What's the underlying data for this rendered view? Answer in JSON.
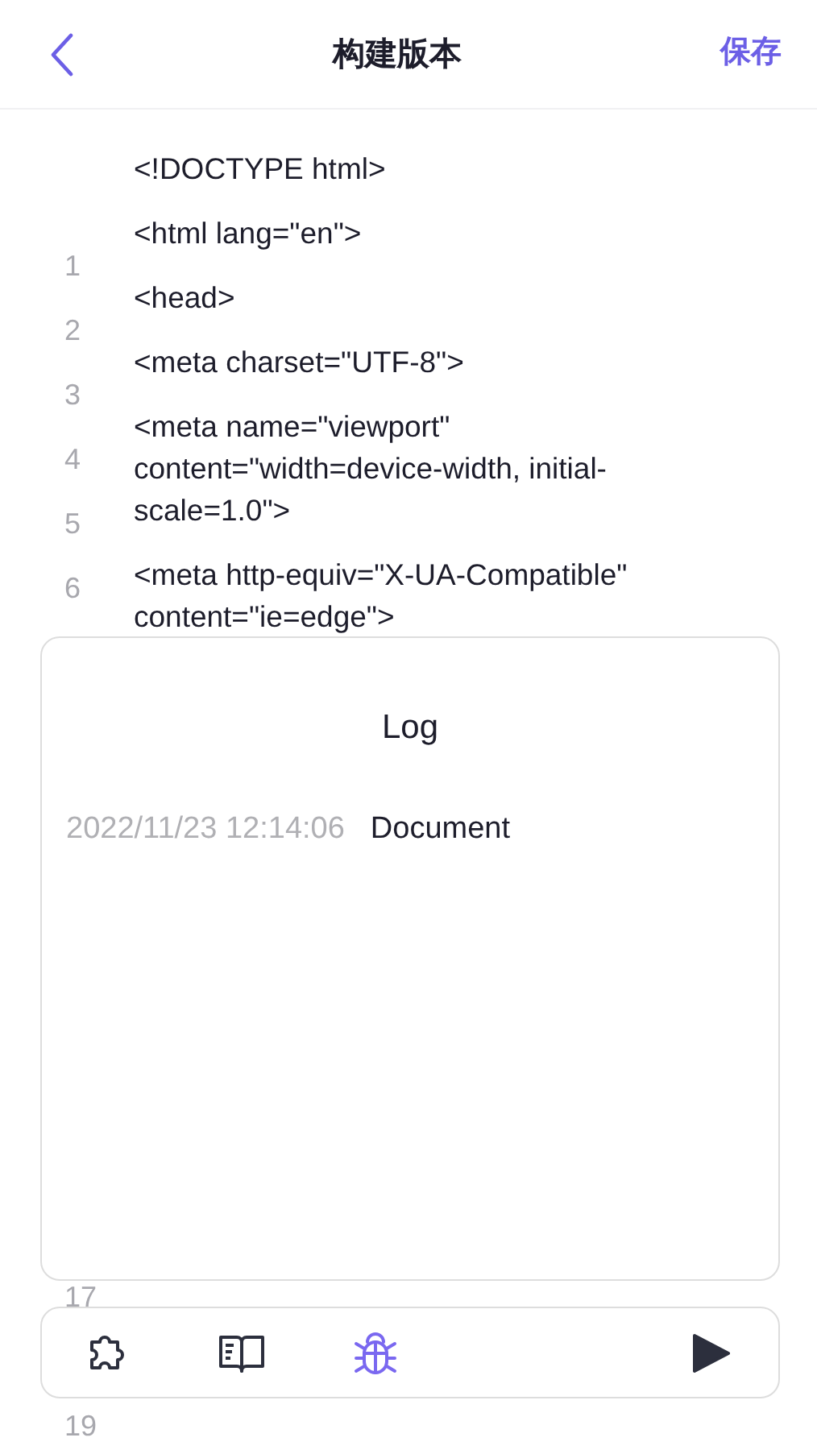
{
  "header": {
    "title": "构建版本",
    "action": "保存"
  },
  "code_lines": [
    "<!DOCTYPE html>",
    "<html lang=\"en\">",
    "<head>",
    "<meta charset=\"UTF-8\">",
    "<meta name=\"viewport\" content=\"width=device-width, initial-scale=1.0\">",
    "<meta http-equiv=\"X-UA-Compatible\" content=\"ie=edge\">"
  ],
  "line_number_groups": [
    [
      "1",
      "2",
      "3",
      "4",
      "5",
      "6"
    ],
    [
      "17"
    ],
    [
      "19"
    ]
  ],
  "log_panel": {
    "title": "Log",
    "entries": [
      {
        "time": "2022/11/23 12:14:06",
        "message": "Document"
      }
    ]
  },
  "toolbar": {
    "tools": [
      {
        "kind": "plugin",
        "selected": false
      },
      {
        "kind": "docs",
        "selected": false
      },
      {
        "kind": "debug",
        "selected": true
      }
    ],
    "run": {
      "kind": "play"
    }
  }
}
